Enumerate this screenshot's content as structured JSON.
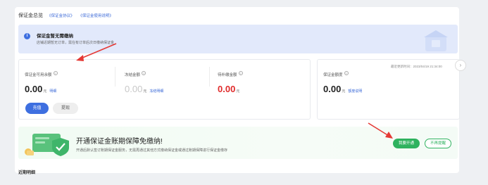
{
  "header": {
    "title": "保证金总览",
    "links": [
      "《保证金协议》",
      "《保证金使用说明》"
    ]
  },
  "notice": {
    "title": "保证金暂无需缴纳",
    "desc": "店铺近期暂无订单，需在有订单后次日缴纳保证金"
  },
  "metrics": [
    {
      "label": "保证金可用余额",
      "value": "0.00",
      "unit": "元",
      "sub": "明细"
    },
    {
      "label": "冻结金额",
      "value": "0.00",
      "unit": "元",
      "sub": "冻结明细"
    },
    {
      "label": "待补缴金额",
      "value": "0.00",
      "unit": "元",
      "sub": ""
    }
  ],
  "actions": {
    "recharge": "充值",
    "withdraw": "提现"
  },
  "right_panel": {
    "updated": "最近更新时间：2023/04/19 21:34:00",
    "label": "保证金额度",
    "value": "0.00",
    "unit": "元",
    "sub": "额度说明"
  },
  "promo": {
    "title": "开通保证金账期保障免缴纳!",
    "desc": "开通后默认签订账期保证金服务，无需再通过其他方式缴纳保证金或通过账期保障进行保证金缴存",
    "open_button": "我要开通",
    "dismiss_button": "不再提醒"
  },
  "footer": {
    "label": "近期明细"
  },
  "colors": {
    "primary": "#3e6fe0",
    "alert_red": "#e02b2b",
    "green": "#2fb25f",
    "annotation_arrow": "#e53935"
  }
}
